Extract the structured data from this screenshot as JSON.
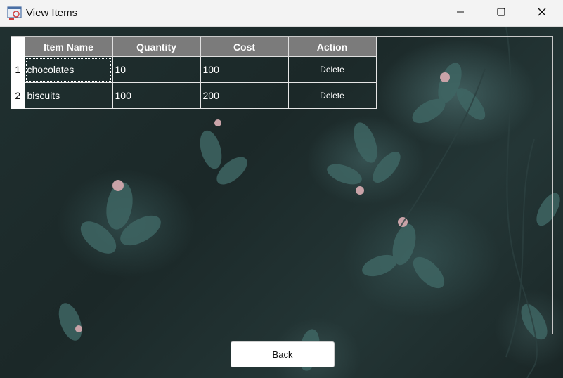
{
  "window": {
    "title": "View Items",
    "icon": "app-window-icon",
    "controls": [
      "minimize-icon",
      "maximize-icon",
      "close-icon"
    ]
  },
  "table": {
    "headers": [
      "Item Name",
      "Quantity",
      "Cost",
      "Action"
    ],
    "rows": [
      {
        "num": "1",
        "item_name": "chocolates",
        "quantity": "10",
        "cost": "100",
        "action": "Delete"
      },
      {
        "num": "2",
        "item_name": "biscuits",
        "quantity": "100",
        "cost": "200",
        "action": "Delete"
      }
    ]
  },
  "footer": {
    "back_label": "Back"
  },
  "colors": {
    "header_bg": "#7b7b7b",
    "background": "#1d2a2a",
    "titlebar": "#f3f3f3"
  }
}
